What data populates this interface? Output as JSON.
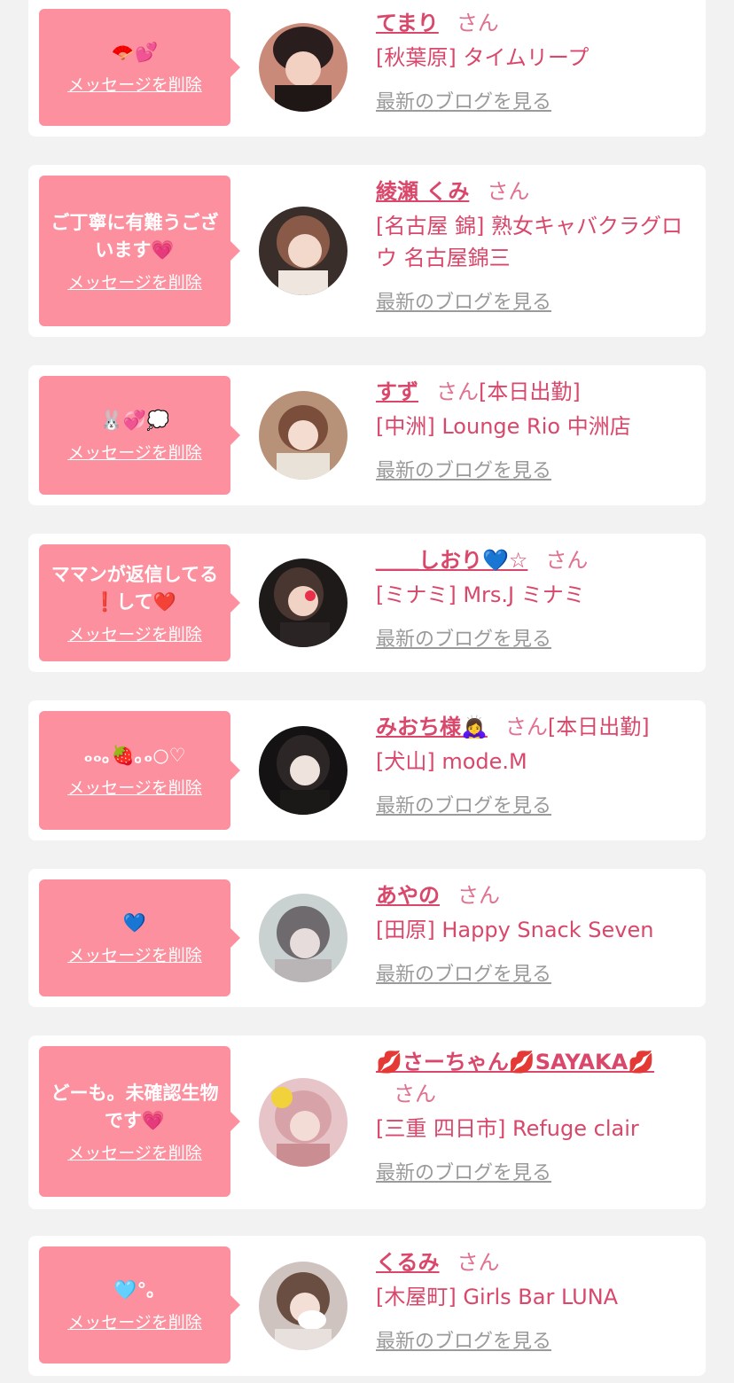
{
  "common": {
    "delete_label": "メッセージを削除",
    "san_label": "さん",
    "blog_label": "最新のブログを見る"
  },
  "colors": {
    "background": "#f2f2f2",
    "card": "#ffffff",
    "bubble": "#fc909e",
    "name": "#d9476b",
    "link_gray": "#9a9a9a"
  },
  "messages": [
    {
      "message": "🪭💕",
      "name": "てまり",
      "status": "",
      "shop": "[秋葉原] タイムリープ"
    },
    {
      "message": "ご丁寧に有難うございます💗",
      "name": "綾瀬 くみ",
      "status": "",
      "shop": "[名古屋 錦] 熟女キャバクラグロウ 名古屋錦三"
    },
    {
      "message": "🐰💞💭",
      "name": "すず",
      "status": "[本日出勤]",
      "shop": "[中洲] Lounge Rio 中洲店"
    },
    {
      "message": "ママンが返信してる❗️して❤️",
      "name": "＿＿しおり💙☆",
      "status": "",
      "shop": "[ミナミ] Mrs.J ミナミ"
    },
    {
      "message": "ₒₒ｡🍓｡ₒ○♡",
      "name": "みおち様🙇‍♀️",
      "status": "[本日出勤]",
      "shop": "[犬山] mode.M"
    },
    {
      "message": "💙",
      "name": "あやの",
      "status": "",
      "shop": "[田原] Happy Snack Seven"
    },
    {
      "message": "どーも。未確認生物です💗",
      "name": "💋さーちゃん💋SAYAKA💋",
      "status": "",
      "shop": "[三重 四日市] Refuge clair"
    },
    {
      "message": "🩵°｡",
      "name": "くるみ",
      "status": "",
      "shop": "[木屋町] Girls Bar LUNA"
    }
  ]
}
